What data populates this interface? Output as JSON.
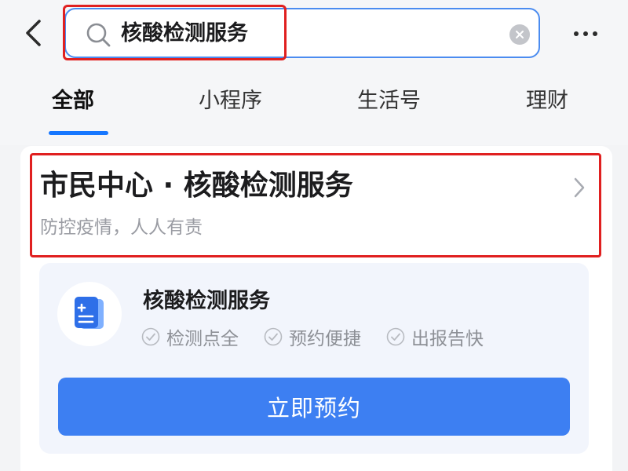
{
  "search": {
    "query": "核酸检测服务",
    "back_icon": "chevron-left-icon",
    "search_icon": "magnifier-icon",
    "clear_icon": "clear-x-icon",
    "more_icon": "more-dots-icon"
  },
  "tabs": [
    {
      "label": "全部",
      "active": true
    },
    {
      "label": "小程序",
      "active": false
    },
    {
      "label": "生活号",
      "active": false
    },
    {
      "label": "理财",
      "active": false
    }
  ],
  "result": {
    "title": "市民中心 · 核酸检测服务",
    "subtitle": "防控疫情，人人有责"
  },
  "service": {
    "name": "核酸检测服务",
    "icon": "medical-document-icon",
    "features": [
      "检测点全",
      "预约便捷",
      "出报告快"
    ],
    "button_label": "立即预约"
  },
  "colors": {
    "accent": "#1677ff",
    "button": "#3d7ff2",
    "highlight": "#e02020",
    "muted_text": "#9a9ca3"
  }
}
